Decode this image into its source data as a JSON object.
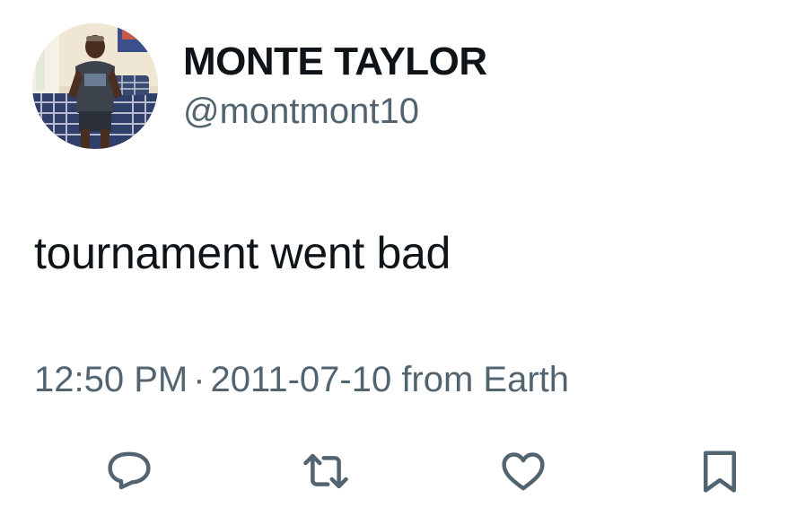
{
  "author": {
    "display_name": "MONTE TAYLOR",
    "handle": "@montmont10",
    "avatar_icon": "profile-photo"
  },
  "tweet": {
    "text": "tournament went bad",
    "time": "12:50 PM",
    "separator": "·",
    "date": "2011-07-10",
    "source": "from Earth"
  },
  "actions": {
    "reply_icon": "reply-icon",
    "retweet_icon": "retweet-icon",
    "like_icon": "heart-icon",
    "bookmark_icon": "bookmark-icon"
  },
  "colors": {
    "text_primary": "#0f1419",
    "text_secondary": "#536471",
    "background": "#ffffff"
  }
}
